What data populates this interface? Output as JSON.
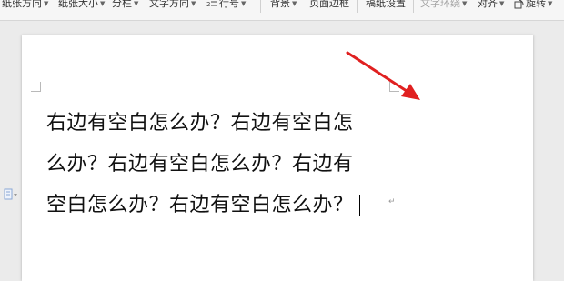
{
  "toolbar": {
    "paper_orientation": "纸张方向",
    "paper_size": "纸张大小",
    "columns": "分栏",
    "text_direction": "文字方向",
    "line_number": "行号",
    "background": "背景",
    "page_border": "页面边框",
    "manuscript_settings": "稿纸设置",
    "text_wrap": "文字环绕",
    "align": "对齐",
    "rotate": "旋转"
  },
  "document": {
    "lines": [
      "右边有空白怎么办？右边有空白怎",
      "么办？右边有空白怎么办？右边有",
      "空白怎么办？右边有空白怎么办？"
    ],
    "paragraph_mark": "↵"
  },
  "colors": {
    "arrow": "#e02020",
    "toolbar_bg": "#f6f6f6",
    "workspace_bg": "#ebebeb",
    "page_bg": "#ffffff"
  },
  "icons": [
    "caret-down-icon",
    "line-number-icon",
    "rotate-icon",
    "document-icon",
    "red-arrow-icon"
  ]
}
